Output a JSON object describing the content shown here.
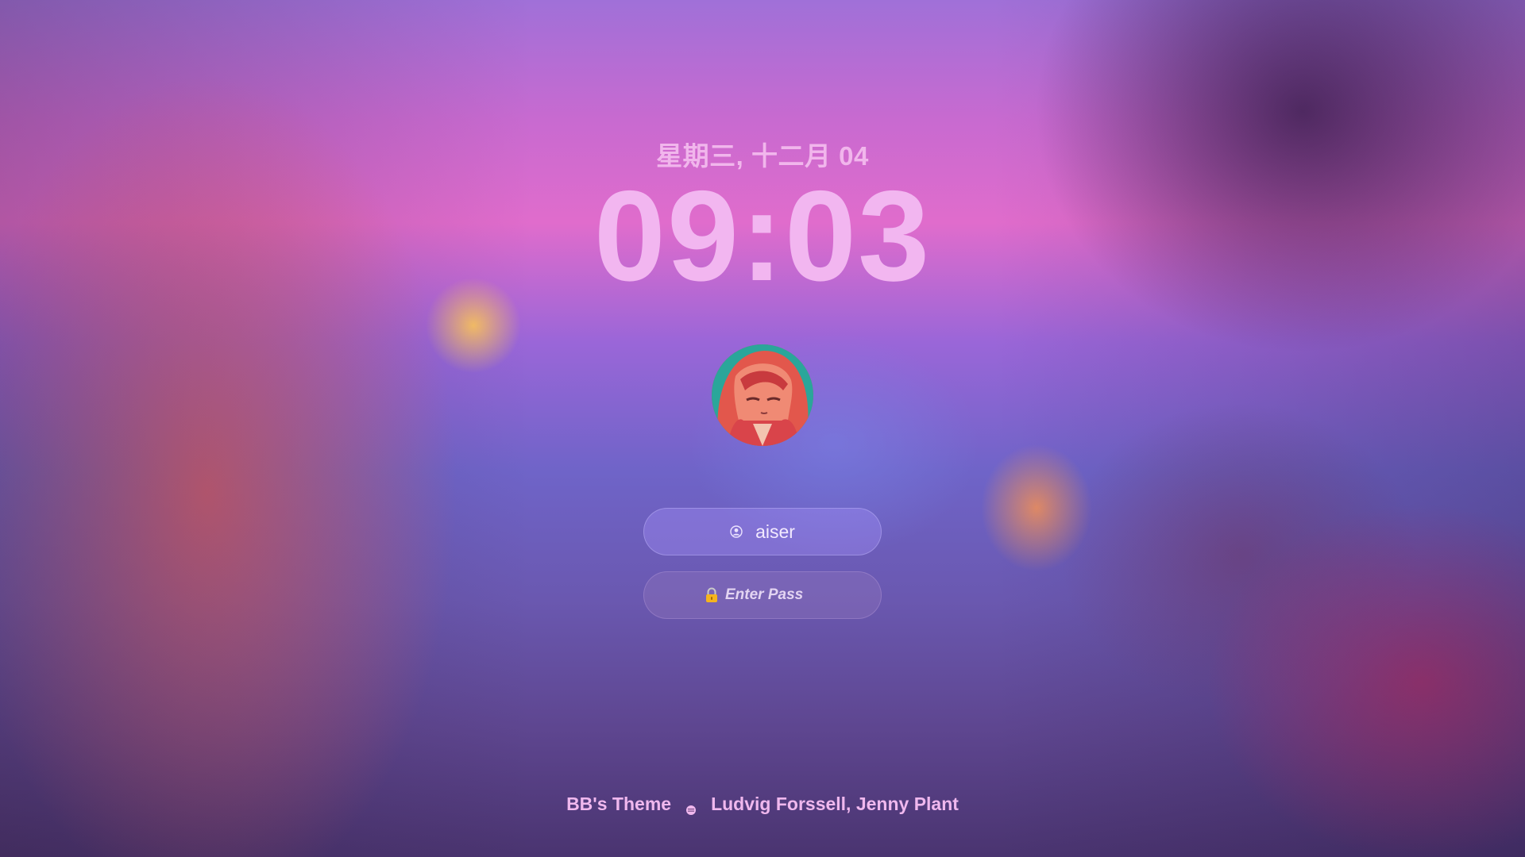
{
  "lockscreen": {
    "date": "星期三, 十二月 04",
    "time": "09:03",
    "username": "aiser",
    "password_placeholder": "Enter Pass"
  },
  "footer": {
    "theme": "BB's Theme",
    "song_artists": "Ludvig Forssell, Jenny Plant"
  },
  "icons": {
    "user": "user-circle-icon",
    "lock": "lock-icon",
    "music": "music-disc-icon"
  },
  "colors": {
    "clock_text": "#f2b6f0",
    "date_text": "#f1b6ec",
    "footer_text": "#f0b8ee"
  }
}
